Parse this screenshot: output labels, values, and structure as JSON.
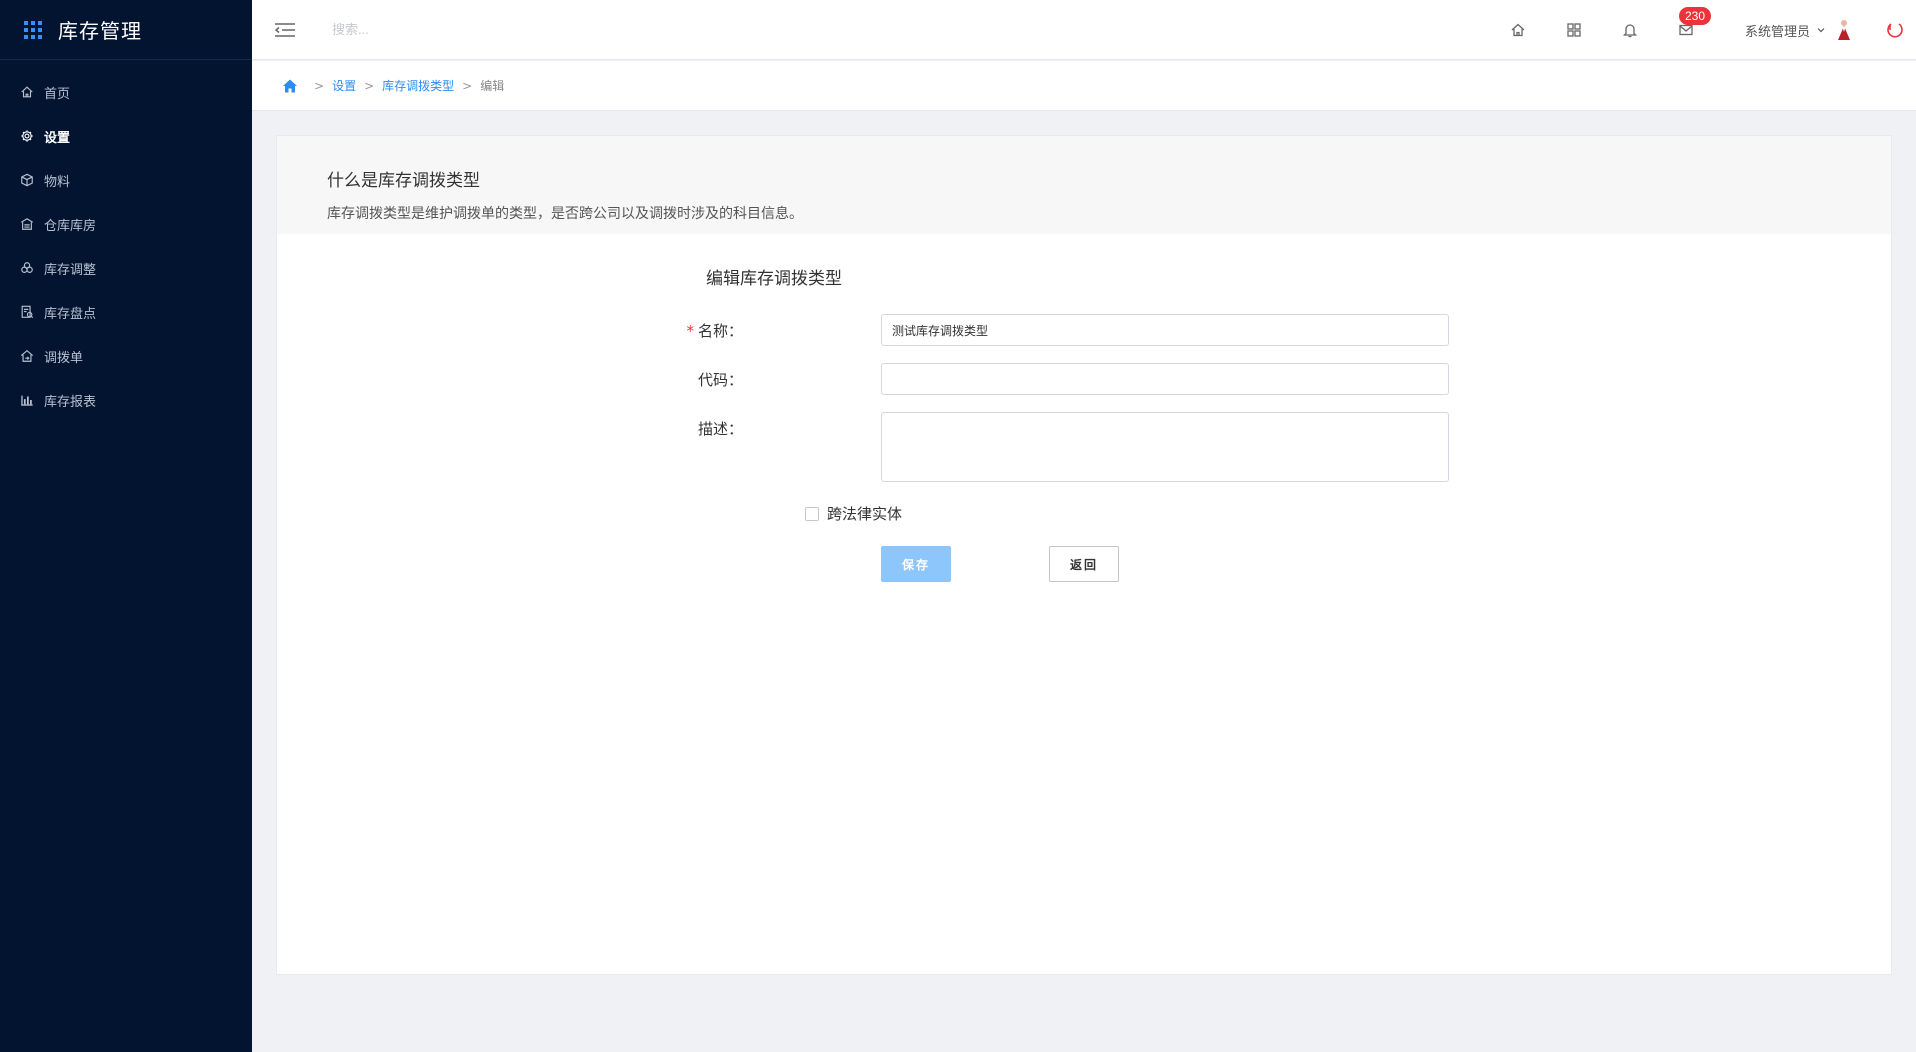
{
  "app": {
    "title": "库存管理"
  },
  "sidebar": {
    "items": [
      {
        "label": "首页",
        "icon": "home-icon"
      },
      {
        "label": "设置",
        "icon": "gear-icon",
        "active": true
      },
      {
        "label": "物料",
        "icon": "box-icon"
      },
      {
        "label": "仓库库房",
        "icon": "warehouse-icon"
      },
      {
        "label": "库存调整",
        "icon": "adjust-icon"
      },
      {
        "label": "库存盘点",
        "icon": "inventory-check-icon"
      },
      {
        "label": "调拨单",
        "icon": "transfer-icon"
      },
      {
        "label": "库存报表",
        "icon": "bar-chart-icon"
      }
    ]
  },
  "topbar": {
    "search_placeholder": "搜索...",
    "mail_badge": "230",
    "user_name": "系统管理员"
  },
  "breadcrumb": {
    "sep": ">",
    "items": [
      "设置",
      "库存调拨类型"
    ],
    "current": "编辑"
  },
  "intro": {
    "title": "什么是库存调拨类型",
    "description": "库存调拨类型是维护调拨单的类型，是否跨公司以及调拨时涉及的科目信息。"
  },
  "form": {
    "title": "编辑库存调拨类型",
    "required_mark": "*",
    "name_label": "名称：",
    "name_value": "测试库存调拨类型",
    "code_label": "代码：",
    "code_value": "",
    "desc_label": "描述：",
    "desc_value": "",
    "cross_entity_label": "跨法律实体",
    "cross_entity_checked": false,
    "save_label": "保存",
    "back_label": "返回"
  },
  "colors": {
    "sidebar_bg": "#031431",
    "accent": "#2d8cf0",
    "save_button": "#8cc6fb",
    "badge": "#e8343a"
  }
}
